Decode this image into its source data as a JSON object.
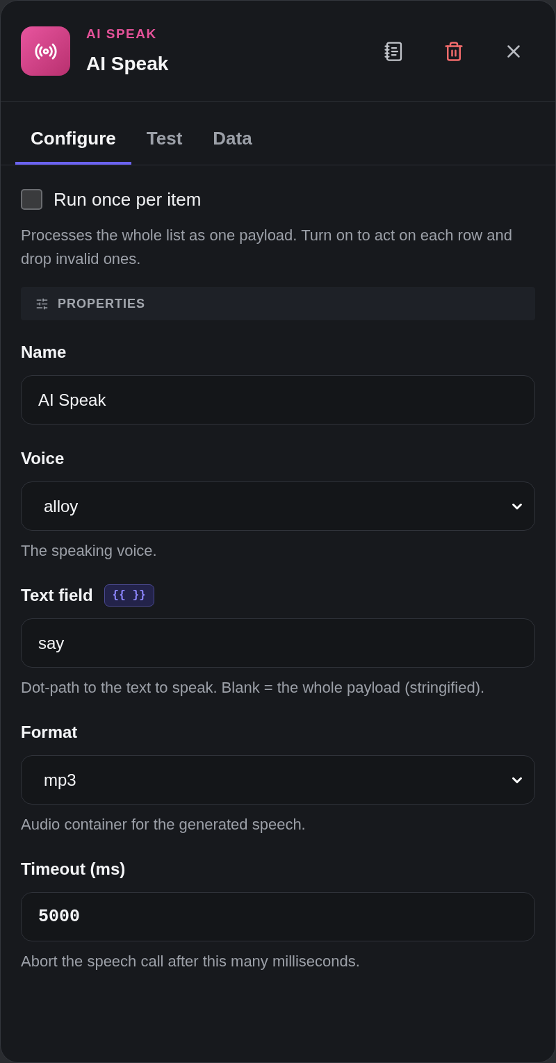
{
  "header": {
    "eyebrow": "AI SPEAK",
    "title": "AI Speak"
  },
  "tabs": [
    {
      "label": "Configure",
      "selected": true
    },
    {
      "label": "Test",
      "selected": false
    },
    {
      "label": "Data",
      "selected": false
    }
  ],
  "run_once": {
    "label": "Run once per item",
    "checked": false,
    "help": "Processes the whole list as one payload. Turn on to act on each row and drop invalid ones."
  },
  "section": {
    "title": "PROPERTIES"
  },
  "fields": [
    {
      "kind": "text",
      "label": "Name",
      "value": "AI Speak"
    },
    {
      "kind": "select",
      "label": "Voice",
      "value": "alloy",
      "help": "The speaking voice."
    },
    {
      "kind": "text",
      "label": "Text field",
      "badge": "{{ }}",
      "value": "say",
      "help": "Dot-path to the text to speak. Blank = the whole payload (stringified)."
    },
    {
      "kind": "select",
      "label": "Format",
      "value": "mp3",
      "help": "Audio container for the generated speech."
    },
    {
      "kind": "number",
      "label": "Timeout (ms)",
      "value": "5000",
      "help": "Abort the speech call after this many milliseconds."
    }
  ]
}
